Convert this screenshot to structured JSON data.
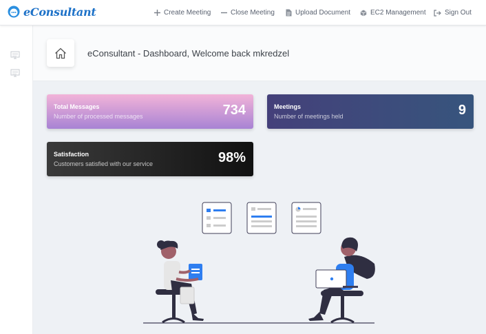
{
  "brand": {
    "name": "eConsultant"
  },
  "nav": [
    {
      "label": "Create Meeting",
      "icon": "plus-icon"
    },
    {
      "label": "Close Meeting",
      "icon": "minus-icon"
    },
    {
      "label": "Upload Document",
      "icon": "file-icon"
    },
    {
      "label": "EC2 Management",
      "icon": "cube-icon"
    },
    {
      "label": "Sign Out",
      "icon": "sign-out-icon"
    }
  ],
  "sidebar": {
    "items": [
      {
        "icon": "monitor-icon"
      },
      {
        "icon": "monitor-icon"
      }
    ]
  },
  "header": {
    "title": "eConsultant - Dashboard, Welcome back mkredzel",
    "icon": "home-icon"
  },
  "cards": [
    {
      "title": "Total Messages",
      "subtitle": "Number of processed messages",
      "value": "734"
    },
    {
      "title": "Meetings",
      "subtitle": "Number of meetings held",
      "value": "9"
    },
    {
      "title": "Satisfaction",
      "subtitle": "Customers satisfied with our service",
      "value": "98%"
    }
  ],
  "colors": {
    "accent": "#1e72c8",
    "illustration_blue": "#2e7ef0"
  }
}
